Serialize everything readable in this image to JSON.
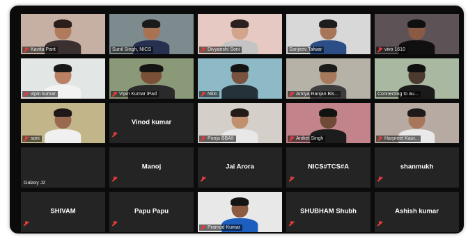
{
  "participants": [
    {
      "name": "Kavita Pant",
      "muted": true,
      "video": true,
      "bg": "#c6b0a3",
      "skin": "#b07a5c",
      "shirt": "#3a3030",
      "hair": "#2a1f1a"
    },
    {
      "name": "Sunil Singh, NICS",
      "muted": false,
      "video": true,
      "active": true,
      "bg": "#7d8a8e",
      "skin": "#a97252",
      "shirt": "#27314f",
      "hair": "#1a1a1a"
    },
    {
      "name": "Divyanshi Soni",
      "muted": true,
      "video": true,
      "bg": "#e7c9c3",
      "skin": "#d2a48c",
      "shirt": "#c4c4c4",
      "hair": "#2a2020"
    },
    {
      "name": "Sanjeev Talwar",
      "muted": false,
      "video": true,
      "bg": "#d8d8d8",
      "skin": "#a7755a",
      "shirt": "#2c4e87",
      "hair": "#1d1d1d"
    },
    {
      "name": "vivo 1610",
      "muted": true,
      "video": true,
      "bg": "#5d5357",
      "skin": "#8b5a44",
      "shirt": "#101010",
      "hair": "#101010"
    },
    {
      "name": "vipin kumar",
      "muted": true,
      "video": true,
      "bg": "#e2e6e4",
      "skin": "#b98064",
      "shirt": "#f2f2f2",
      "hair": "#181818"
    },
    {
      "name": "Vipin Kumar iPad",
      "muted": true,
      "video": true,
      "wide": true,
      "bg": "#8a9a78",
      "skin": "#7a5038",
      "shirt": "#2a2a2a",
      "hair": "#141414"
    },
    {
      "name": "Nitin",
      "muted": true,
      "video": true,
      "bg": "#8eb9c6",
      "skin": "#7a5240",
      "shirt": "#26323a",
      "hair": "#141414"
    },
    {
      "name": "Amiya Ranjan Bis...",
      "muted": true,
      "video": true,
      "bg": "#b7b2a7",
      "skin": "#a6795d",
      "shirt": "#3d3d3d",
      "hair": "#1b1b1b"
    },
    {
      "name": "Connecting to au...",
      "muted": false,
      "video": true,
      "bg": "#a9b8a0",
      "skin": "#4a3a30",
      "shirt": "#1a1a1a",
      "hair": "#101010"
    },
    {
      "name": "soni",
      "muted": true,
      "video": true,
      "bg": "#c2b58a",
      "skin": "#9a6a50",
      "shirt": "#f0f0f0",
      "hair": "#201818"
    },
    {
      "name": "Vinod kumar",
      "muted": true,
      "video": false
    },
    {
      "name": "Pooja BBAII",
      "muted": true,
      "video": true,
      "bg": "#d4cfc9",
      "skin": "#c0906f",
      "shirt": "#e8e8e8",
      "hair": "#241a16"
    },
    {
      "name": "Aniket Singh",
      "muted": true,
      "video": true,
      "bg": "#c2848a",
      "skin": "#6f4a36",
      "shirt": "#1c1c1c",
      "hair": "#121212"
    },
    {
      "name": "Harpreet Kaur...",
      "muted": true,
      "video": true,
      "bg": "#b6aaa3",
      "skin": "#a8765a",
      "shirt": "#e9e9e9",
      "hair": "#1f1a18"
    },
    {
      "name": "Galaxy J2",
      "muted": false,
      "video": false,
      "labelOnly": true
    },
    {
      "name": "Manoj",
      "muted": true,
      "video": false
    },
    {
      "name": "Jai Arora",
      "muted": true,
      "video": false
    },
    {
      "name": "NICS#TCS#A",
      "muted": true,
      "video": false
    },
    {
      "name": "shanmukh",
      "muted": true,
      "video": false
    },
    {
      "name": "SHIVAM",
      "muted": true,
      "video": false
    },
    {
      "name": "Papu Papu",
      "muted": true,
      "video": false
    },
    {
      "name": "Pramod Kumar",
      "muted": true,
      "video": true,
      "bg": "#e8e8e8",
      "skin": "#8d5a42",
      "shirt": "#1d5fbf",
      "hair": "#141414"
    },
    {
      "name": "SHUBHAM Shubh",
      "muted": true,
      "video": false
    },
    {
      "name": "Ashish kumar",
      "muted": true,
      "video": false
    }
  ]
}
